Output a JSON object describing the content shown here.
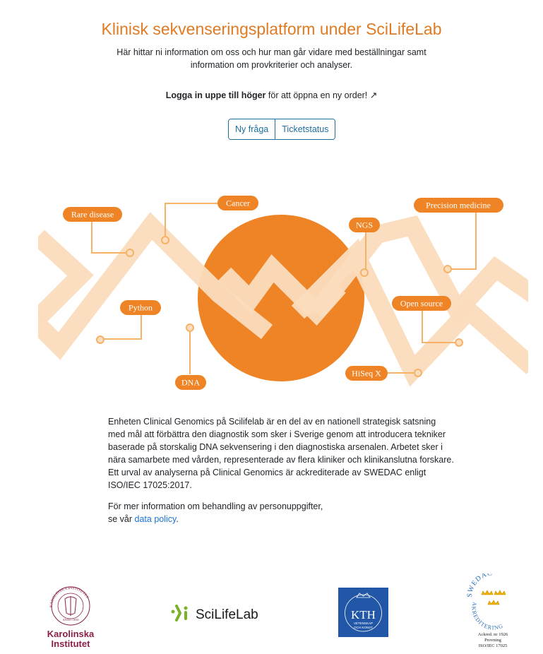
{
  "header": {
    "title": "Klinisk sekvenseringsplatform under SciLifeLab",
    "subtitle": "Här hittar ni information om oss och hur man går vidare med beställningar samt information om provkriterier och analyser.",
    "login_bold": "Logga in uppe till höger",
    "login_rest": " för att öppna en ny order! ↗"
  },
  "buttons": {
    "new_question": "Ny fråga",
    "ticket_status": "Ticketstatus"
  },
  "illustration": {
    "labels": {
      "rare_disease": "Rare disease",
      "cancer": "Cancer",
      "ngs": "NGS",
      "precision_medicine": "Precision medicine",
      "python": "Python",
      "open_source": "Open source",
      "dna": "DNA",
      "hiseq": "HiSeq X"
    },
    "colors": {
      "orange": "#ee8425",
      "band": "#fbdcbd",
      "connector": "#f6b266"
    }
  },
  "content": {
    "paragraph": "Enheten Clinical Genomics på Scilifelab är en del av en nationell strategisk satsning med mål att förbättra den diagnostik som sker i Sverige genom att introducera tekniker baserade på storskalig DNA sekvensering i den diagnostiska arsenalen. Arbetet sker i nära samarbete med vården, representerade av flera kliniker och klinikanslutna forskare. Ett urval av analyserna på Clinical Genomics är ackrediterade av SWEDAC enligt ISO/IEC 17025:2017.",
    "policy_line1": "För mer information om behandling av personuppgifter,",
    "policy_prefix": "se vår ",
    "policy_link": "data policy",
    "policy_suffix": "."
  },
  "logos": {
    "ki_arc": "KAROLINSKA INSTITUTET",
    "ki_year": "ANNO 1810",
    "ki_line1": "Karolinska",
    "ki_line2": "Institutet",
    "scilifelab": "SciLifeLab",
    "kth": "KTH",
    "kth_sub1": "VETENSKAP",
    "kth_sub2": "OCH KONST",
    "swedac_top": "SWEDAC",
    "swedac_arc": "AKREDITERING",
    "swedac_line1": "Ackred. nr 1926",
    "swedac_line2": "Provning",
    "swedac_line3": "ISO/IEC 17025"
  }
}
